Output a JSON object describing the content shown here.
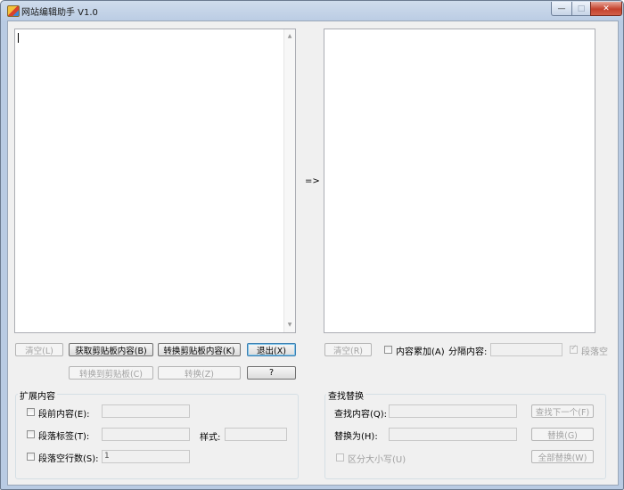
{
  "window": {
    "title": "网站编辑助手 V1.0",
    "controls": {
      "minimize": "—",
      "maximize": "□",
      "close": "✕"
    }
  },
  "left_buttons": {
    "clear": "清空(L)",
    "get_clipboard": "获取剪贴板内容(B)",
    "convert_clipboard": "转换剪贴板内容(K)",
    "exit": "退出(X)",
    "convert_to_clipboard": "转换到剪贴板(C)",
    "convert": "转换(Z)",
    "help": "?"
  },
  "arrow": "=>",
  "right_controls": {
    "clear": "清空(R)",
    "append_label": "内容累加(A)",
    "separator_label": "分隔内容:",
    "separator_value": "",
    "paragraph_empty_label": "段落空"
  },
  "extend_group": {
    "title": "扩展内容",
    "before_label": "段前内容(E):",
    "before_value": "",
    "tag_label": "段落标签(T):",
    "tag_value": "",
    "style_label": "样式:",
    "style_value": "",
    "blank_lines_label": "段落空行数(S):",
    "blank_lines_value": "1"
  },
  "find_group": {
    "title": "查找替换",
    "find_label": "查找内容(Q):",
    "find_value": "",
    "replace_label": "替换为(H):",
    "replace_value": "",
    "case_label": "区分大小写(U)",
    "find_next": "查找下一个(F)",
    "replace": "替换(G)",
    "replace_all": "全部替换(W)"
  }
}
